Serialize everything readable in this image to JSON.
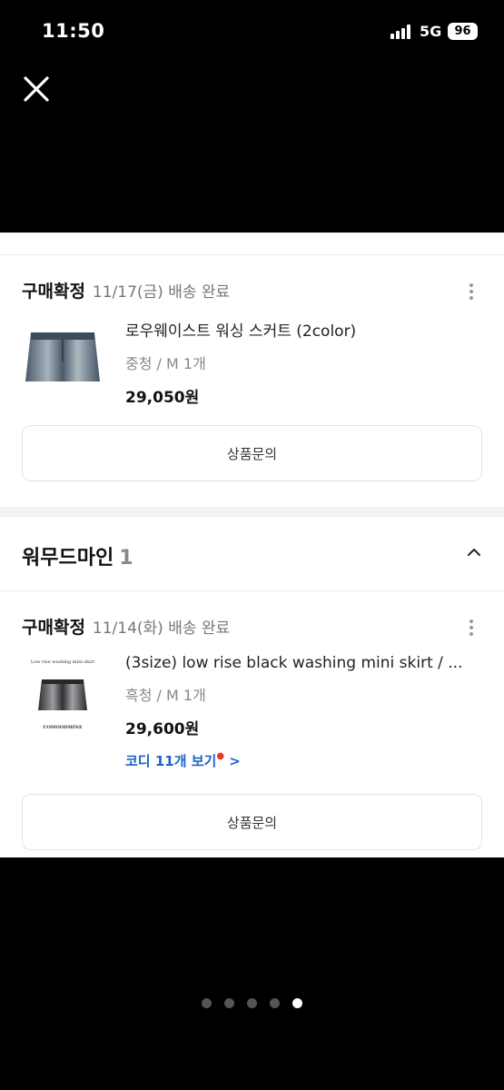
{
  "status_bar": {
    "time": "11:50",
    "network": "5G",
    "battery": "96"
  },
  "orders": [
    {
      "status": "구매확정",
      "date": "11/17(금) 배송 완료",
      "product_name": "로우웨이스트 워싱 스커트 (2color)",
      "option": "중청 / M 1개",
      "price": "29,050원",
      "inquiry_label": "상품문의"
    },
    {
      "status": "구매확정",
      "date": "11/14(화) 배송 완료",
      "product_name": "(3size) low rise black washing mini skirt / ...",
      "option": "흑청 / M 1개",
      "price": "29,600원",
      "coordi_label": "코디 11개 보기",
      "coordi_arrow": ">",
      "inquiry_label": "상품문의",
      "thumb_caption": "Low rise washing mini skirt",
      "thumb_brand": "UOMOODMINE"
    }
  ],
  "store": {
    "name": "워무드마인",
    "count": "1"
  },
  "pager": {
    "total": 5,
    "active": 4
  },
  "icons": {
    "close": "close-icon",
    "more": "more-vertical-icon",
    "collapse": "chevron-up-icon",
    "coordi_dot": "red-dot-icon"
  },
  "colors": {
    "accent_link": "#1a62c8",
    "badge_dot": "#e33333",
    "backdrop": "#000000"
  }
}
